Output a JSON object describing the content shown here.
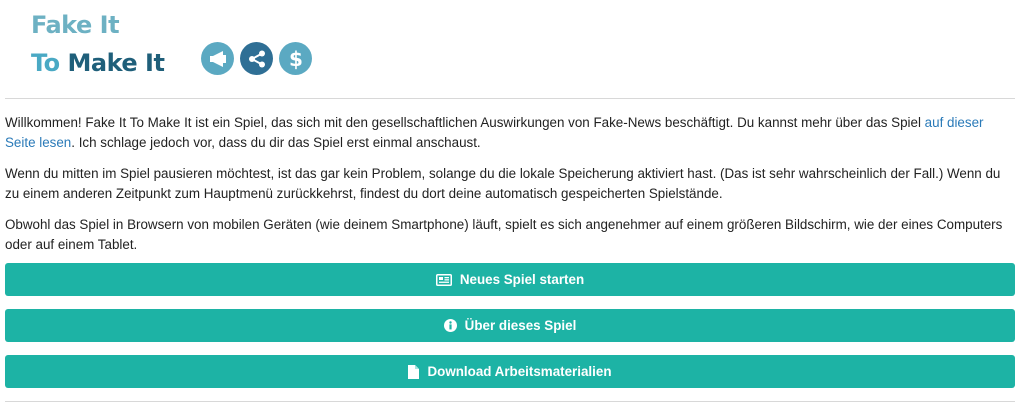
{
  "header": {
    "logo_line1": "Fake It",
    "logo_to": "To",
    "logo_make_it": "Make It",
    "logo_icons": [
      "megaphone-icon",
      "share-icon",
      "dollar-icon"
    ],
    "colors": {
      "logo_light": "#6db1c3",
      "logo_dark": "#1f5f7a",
      "icon_light": "#5ba9c2",
      "icon_dark": "#2f6f95"
    }
  },
  "intro": {
    "p1_text": "Willkommen! Fake It To Make It ist ein Spiel, das sich mit den gesellschaftlichen Auswirkungen von Fake-News beschäftigt. Du kannst mehr über das Spiel ",
    "p1_link": "auf dieser Seite lesen",
    "p1_after": ". Ich schlage jedoch vor, dass du dir das Spiel erst einmal anschaust.",
    "p2": "Wenn du mitten im Spiel pausieren möchtest, ist das gar kein Problem, solange du die lokale Speicherung aktiviert hast. (Das ist sehr wahrscheinlich der Fall.) Wenn du zu einem anderen Zeitpunkt zum Hauptmenü zurückkehrst, findest du dort deine automatisch gespeicherten Spielstände.",
    "p3": "Obwohl das Spiel in Browsern von mobilen Geräten (wie deinem Smartphone) läuft, spielt es sich angenehmer auf einem größeren Bildschirm, wie der eines Computers oder auf einem Tablet."
  },
  "buttons": {
    "new_game": {
      "label": "Neues Spiel starten",
      "icon": "newspaper-icon"
    },
    "about": {
      "label": "Über dieses Spiel",
      "icon": "info-icon"
    },
    "download": {
      "label": "Download Arbeitsmaterialien",
      "icon": "file-icon"
    },
    "color": "#1db3a5"
  }
}
